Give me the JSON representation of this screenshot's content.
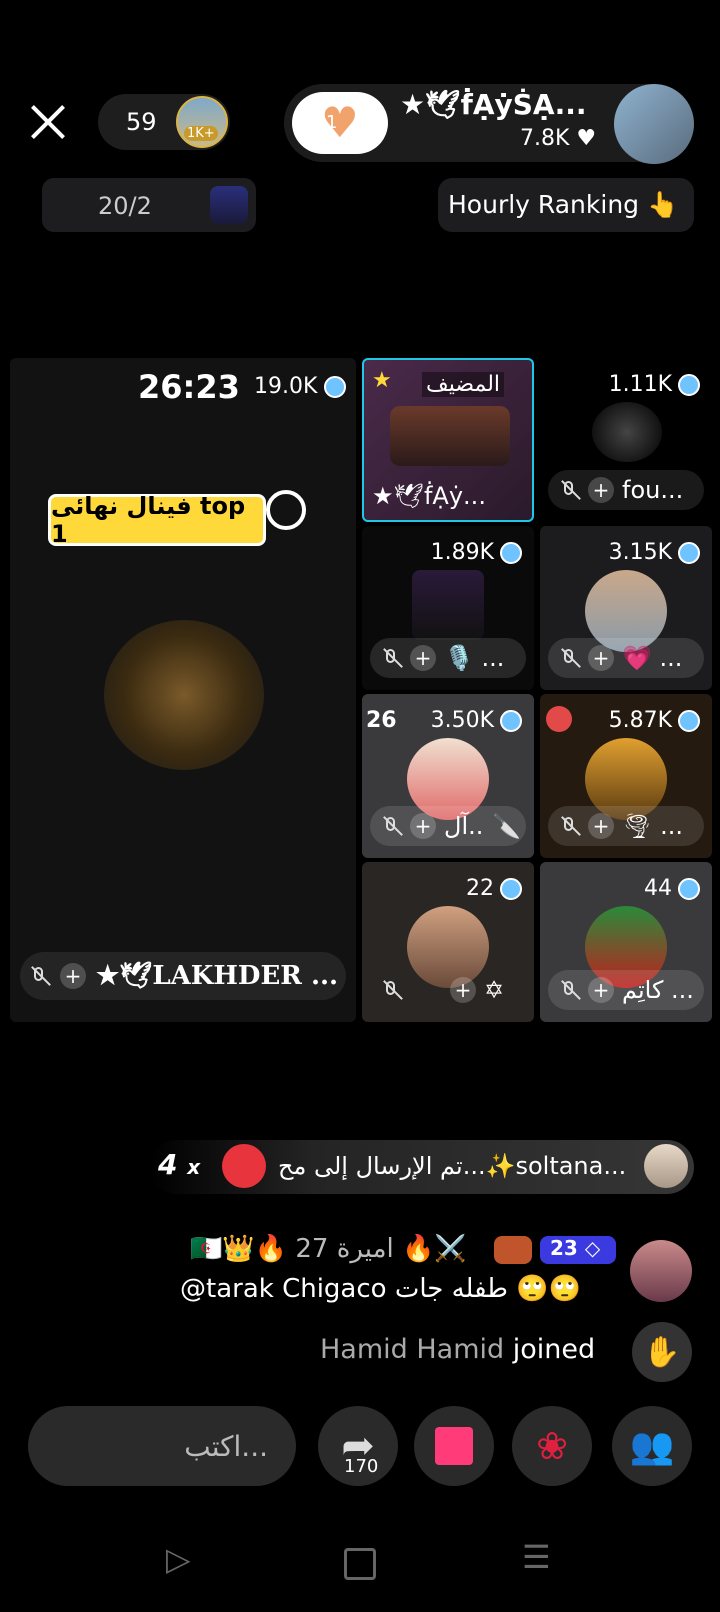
{
  "header": {
    "viewer_count": "59",
    "viewer_badge": "1K+",
    "host_name": "★🕊ḟẠẏṠẠ...",
    "host_likes": "7.8K",
    "like_count": "1",
    "progress_text": "20/2",
    "ranking_label": "Hourly Ranking 👆"
  },
  "main_tile": {
    "timer": "26:23",
    "score": "19.0K",
    "tag": "فينال نهائى top 1",
    "name": "★🕊LAKHDER ..."
  },
  "tiles": [
    {
      "score": "",
      "label_top": "المضيف",
      "name": "★🕊ḟẠẏ..."
    },
    {
      "score": "1.11K",
      "name": "fou..."
    },
    {
      "score": "1.89K",
      "name": "🎙️ ..."
    },
    {
      "score": "3.15K",
      "name": "💗 ..."
    },
    {
      "score": "3.50K",
      "prefix": "26",
      "name": "آل.. 🔪"
    },
    {
      "score": "5.87K",
      "name": "🌪 ..."
    },
    {
      "score": "22",
      "name": "✡"
    },
    {
      "score": "44",
      "name": "كاتِم ..."
    }
  ],
  "gift_banner": {
    "count": "4",
    "x": "x",
    "text": "تم الإرسال إلى مح...✨soltana..."
  },
  "comment": {
    "level": "23",
    "user_line": "🇩🇿👑🔥 اميرة 27 🔥⚔️",
    "text": "@tarak Chigaco طفله جات 🙄🙄"
  },
  "join": {
    "name": "Hamid Hamid",
    "action": "joined"
  },
  "bottom": {
    "input_placeholder": "اكتب...",
    "share_count": "170"
  }
}
